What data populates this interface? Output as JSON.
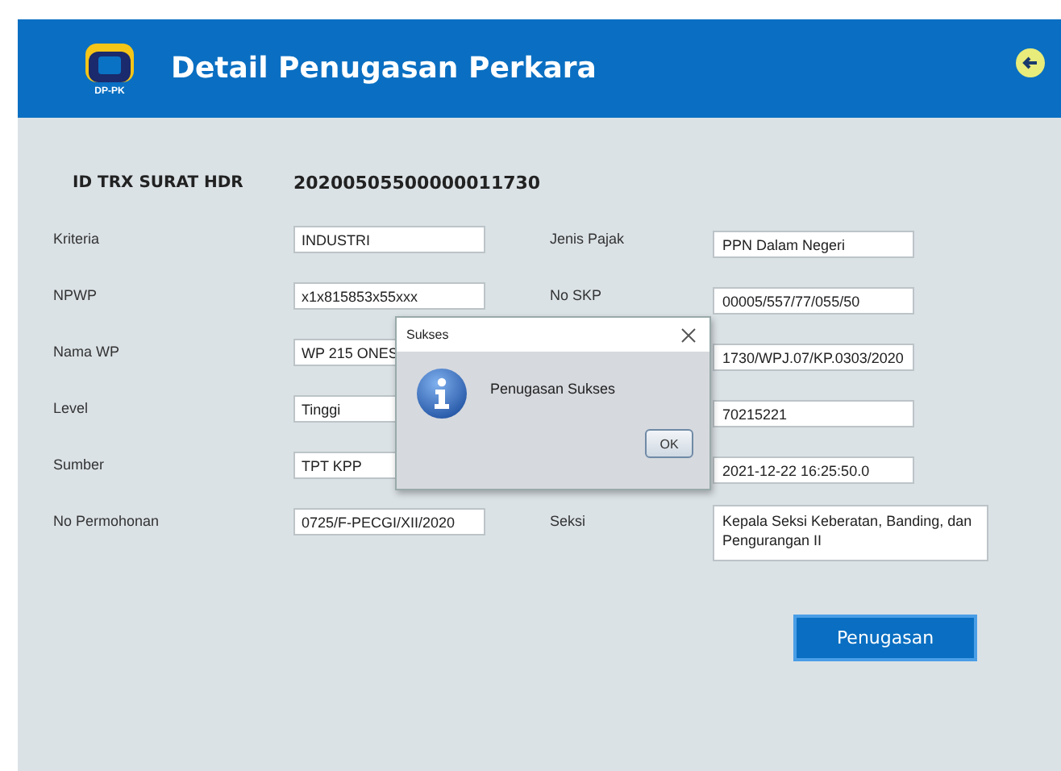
{
  "header": {
    "logo_text": "DP-PK",
    "title": "Detail Penugasan Perkara"
  },
  "id_row": {
    "label": "ID TRX SURAT HDR",
    "value": "20200505500000011730"
  },
  "left_fields": [
    {
      "label": "Kriteria",
      "value": "INDUSTRI",
      "kind": "text"
    },
    {
      "label": "NPWP",
      "value": "x1x815853x55xxx",
      "kind": "text"
    },
    {
      "label": "Nama WP",
      "value": "WP 215 ONES",
      "kind": "text"
    },
    {
      "label": "Level",
      "value": "Tinggi",
      "kind": "text"
    },
    {
      "label": "Sumber",
      "value": "TPT KPP",
      "kind": "text"
    },
    {
      "label": "No Permohonan",
      "value": "0725/F-PECGI/XII/2020",
      "kind": "text"
    }
  ],
  "right_fields": [
    {
      "label": "Jenis Pajak",
      "value": "PPN Dalam Negeri",
      "kind": "text"
    },
    {
      "label": "No SKP",
      "value": "00005/557/77/055/50",
      "kind": "text"
    },
    {
      "value": "1730/WPJ.07/KP.0303/2020",
      "kind": "text"
    },
    {
      "value": "70215221",
      "kind": "text"
    },
    {
      "value": "2021-12-22 16:25:50.0",
      "kind": "text"
    },
    {
      "label": "Seksi",
      "value": "Kepala Seksi Keberatan, Banding, dan Pengurangan II",
      "kind": "area"
    }
  ],
  "action_button": "Penugasan",
  "dialog": {
    "title": "Sukses",
    "message": "Penugasan Sukses",
    "button": "OK"
  }
}
